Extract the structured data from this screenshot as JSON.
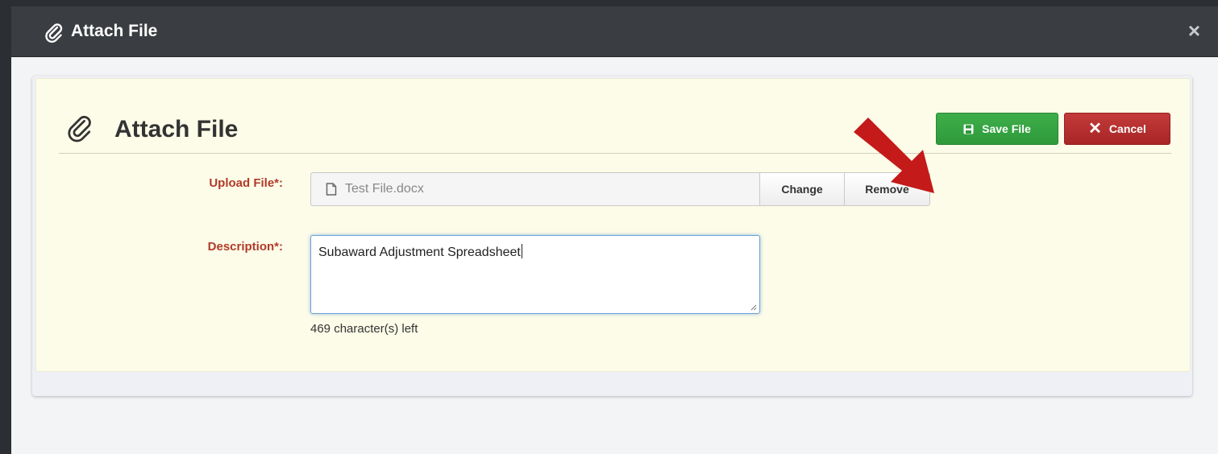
{
  "modal": {
    "title": "Attach File",
    "close_label": "×"
  },
  "panel": {
    "title": "Attach File",
    "save_label": "Save File",
    "cancel_label": "Cancel"
  },
  "form": {
    "upload_label": "Upload File*:",
    "file_name": "Test File.docx",
    "change_label": "Change",
    "remove_label": "Remove",
    "description_label": "Description*:",
    "description_value": "Subaward Adjustment Spreadsheet",
    "chars_left": "469 character(s) left"
  },
  "icons": {
    "header": "paperclip-icon",
    "title": "paperclip-icon",
    "save": "floppy-disk-icon",
    "cancel": "x-icon",
    "file": "document-icon",
    "callout": "red-arrow"
  },
  "colors": {
    "header_bg": "#3a3d41",
    "panel_bg": "#fcfce8",
    "save_green": "#3eae4a",
    "cancel_red": "#c33a3a",
    "label_red": "#b23a2a",
    "arrow_red": "#c41a1a"
  }
}
